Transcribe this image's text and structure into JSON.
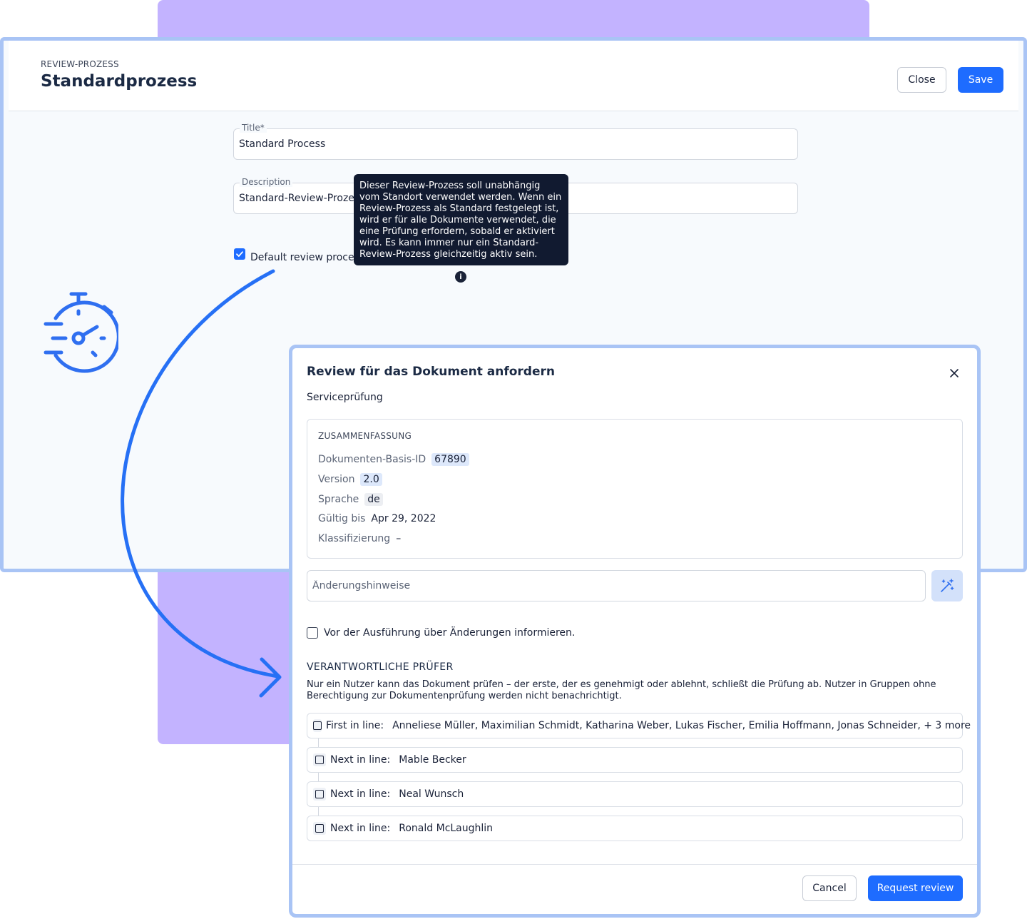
{
  "header": {
    "eyebrow": "REVIEW-PROZESS",
    "title": "Standardprozess",
    "close_label": "Close",
    "save_label": "Save"
  },
  "form": {
    "title_label": "Title*",
    "title_value": "Standard Process",
    "description_label": "Description",
    "description_value": "Standard-Review-Prozess",
    "default_checkbox_label": "Default review process",
    "default_checked": true
  },
  "tooltip": {
    "text": "Dieser Review-Prozess soll unabhängig vom Standort verwendet werden. Wenn ein Review-Prozess als Standard festgelegt ist, wird er für alle Dokumente verwendet, die eine Prüfung erfordern, sobald er aktiviert wird. Es kann immer nur ein Standard-Review-Prozess gleichzeitig aktiv sein."
  },
  "icons": {
    "stopwatch": "stopwatch-icon",
    "info": "info-icon",
    "close": "close-icon",
    "magic": "magic-wand-icon",
    "arrow": "curved-arrow"
  },
  "colors": {
    "primary": "#1e6cff",
    "panel_border": "#a9c4f5",
    "purple_bg": "#c3b3ff",
    "tooltip_bg": "#111a30"
  },
  "modal": {
    "title": "Review für das Dokument anfordern",
    "subtitle": "Serviceprüfung",
    "summary": {
      "heading": "ZUSAMMENFASSUNG",
      "rows": [
        {
          "label": "Dokumenten-Basis-ID",
          "value": "67890"
        },
        {
          "label": "Version",
          "value": "2.0"
        },
        {
          "label": "Sprache",
          "value": "de"
        },
        {
          "label": "Gültig bis",
          "value": "Apr 29, 2022"
        },
        {
          "label": "Klassifizierung",
          "value": "–"
        }
      ]
    },
    "notes_placeholder": "Änderungshinweise",
    "inform_label": "Vor der Ausführung über Änderungen informieren.",
    "reviewers_heading": "VERANTWORTLICHE PRÜFER",
    "reviewers_description": "Nur ein Nutzer kann das Dokument prüfen – der erste, der es genehmigt oder ablehnt, schließt die Prüfung ab. Nutzer in Gruppen ohne Berechtigung zur Dokumentenprüfung werden nicht benachrichtigt.",
    "reviewers": [
      {
        "prefix": "First in line:",
        "names": "Anneliese Müller, Maximilian Schmidt, Katharina Weber, Lukas Fischer, Emilia Hoffmann, Jonas Schneider, + 3 more"
      },
      {
        "prefix": "Next in line:",
        "names": "Mable Becker"
      },
      {
        "prefix": "Next in line:",
        "names": "Neal Wunsch"
      },
      {
        "prefix": "Next in line:",
        "names": "Ronald McLaughlin"
      }
    ],
    "cancel_label": "Cancel",
    "request_label": "Request review"
  }
}
